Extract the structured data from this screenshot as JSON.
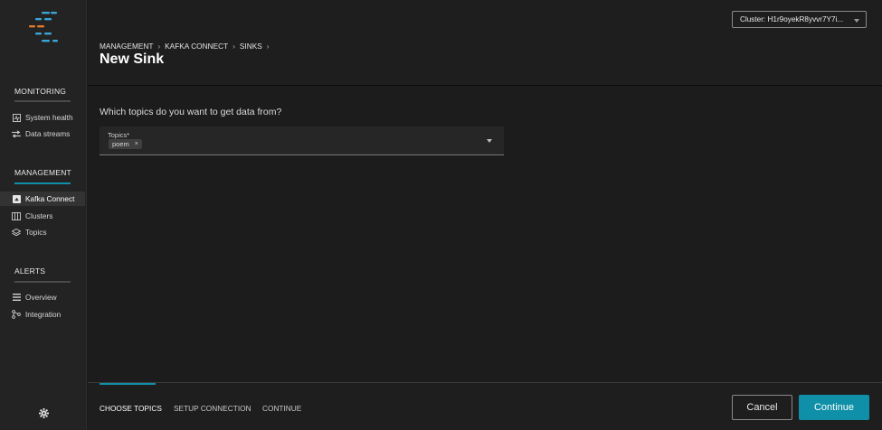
{
  "sidebar": {
    "sections": [
      {
        "title": "MONITORING",
        "items": [
          {
            "label": "System health",
            "icon": "heart-monitor-icon"
          },
          {
            "label": "Data streams",
            "icon": "streams-icon"
          }
        ]
      },
      {
        "title": "MANAGEMENT",
        "items": [
          {
            "label": "Kafka Connect",
            "icon": "connect-icon"
          },
          {
            "label": "Clusters",
            "icon": "clusters-icon"
          },
          {
            "label": "Topics",
            "icon": "layers-icon"
          }
        ]
      },
      {
        "title": "ALERTS",
        "items": [
          {
            "label": "Overview",
            "icon": "list-icon"
          },
          {
            "label": "Integration",
            "icon": "integration-icon"
          }
        ]
      }
    ],
    "active_item": "Kafka Connect"
  },
  "header": {
    "breadcrumb": [
      "MANAGEMENT",
      "KAFKA CONNECT",
      "SINKS"
    ],
    "title": "New Sink",
    "cluster_select": "Cluster: H1r9oyekR8yvvr7Y7i..."
  },
  "main": {
    "question": "Which topics do you want to get data from?",
    "topics_label": "Topics*",
    "selected_topics": [
      "poem"
    ],
    "chip_remove": "×"
  },
  "footer": {
    "steps": [
      "CHOOSE TOPICS",
      "SETUP CONNECTION",
      "CONTINUE"
    ],
    "active_step": "CHOOSE TOPICS",
    "cancel_label": "Cancel",
    "continue_label": "Continue"
  },
  "colors": {
    "accent": "#0f8fa8",
    "background": "#1c1c1c",
    "sidebar": "#232323",
    "logo_blue": "#3aa6d8",
    "logo_orange": "#e07a2c"
  }
}
